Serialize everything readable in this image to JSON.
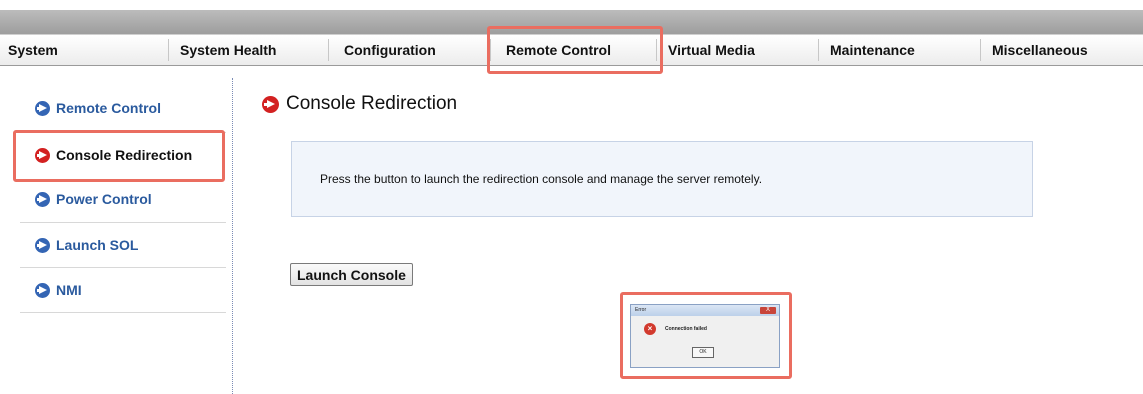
{
  "nav": {
    "tabs": [
      {
        "label": "System"
      },
      {
        "label": "System Health"
      },
      {
        "label": "Configuration"
      },
      {
        "label": "Remote Control",
        "active": true
      },
      {
        "label": "Virtual Media"
      },
      {
        "label": "Maintenance"
      },
      {
        "label": "Miscellaneous"
      }
    ]
  },
  "sidebar": {
    "items": [
      {
        "label": "Remote Control",
        "icon": "arrow-right-circle-icon"
      },
      {
        "label": "Console Redirection",
        "icon": "arrow-right-circle-red-icon",
        "active": true
      },
      {
        "label": "Power Control",
        "icon": "arrow-right-circle-icon"
      },
      {
        "label": "Launch SOL",
        "icon": "arrow-right-circle-icon"
      },
      {
        "label": "NMI",
        "icon": "arrow-right-circle-icon"
      }
    ]
  },
  "main": {
    "title": "Console Redirection",
    "info_text": "Press the button to launch the redirection console and manage the server remotely.",
    "launch_button": "Launch Console"
  },
  "dialog": {
    "title": "Error",
    "message": "Connection failed",
    "ok_label": "OK",
    "close_label": "X"
  },
  "colors": {
    "link_blue": "#2a5a9e",
    "active_red": "#d32121",
    "highlight": "#ea6d60",
    "info_bg": "#f1f5fb"
  }
}
